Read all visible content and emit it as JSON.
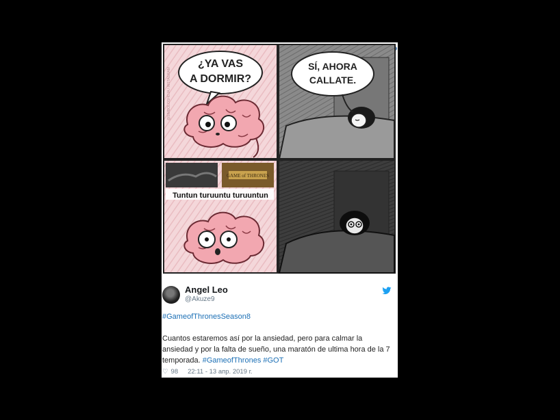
{
  "comic": {
    "panel1_text": "¿YA VAS A DORMIR?",
    "panel2_text": "SÍ, AHORA CALLATE.",
    "panel3_caption": "Tuntun turuuntu turuuntun",
    "credit_text": "@SIMBOLOSHOJA / INSTAGRAM"
  },
  "tweet": {
    "author_name": "Angel Leo",
    "author_handle": "@Akuze9",
    "hashtag_line": "#GameofThronesSeason8",
    "body_text": "Cuantos estaremos así por la ansiedad, pero para calmar la ansiedad y por la falta de sueño, una maratón de ultima hora de la 7 temporada.",
    "body_tags": "#GameofThrones #GOT",
    "likes": "98",
    "timestamp": "22:11 - 13 апр. 2019 г.",
    "icons": {
      "bird": "twitter-bird-icon",
      "heart": "heart-icon"
    },
    "colors": {
      "link": "#1b6fb5",
      "bird": "#1da1f2"
    }
  }
}
